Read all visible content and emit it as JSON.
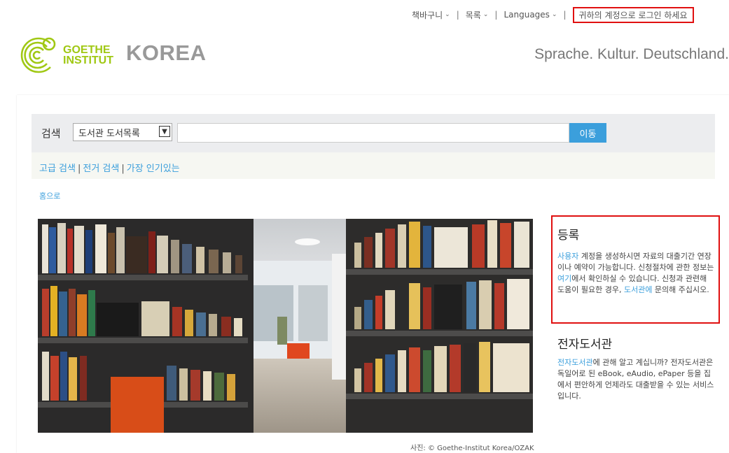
{
  "topnav": {
    "cart": "책바구니",
    "list": "목록",
    "languages": "Languages",
    "login": "귀하의 계정으로 로그인 하세요"
  },
  "header": {
    "logo_line1": "GOETHE",
    "logo_line2": "INSTITUT",
    "site_name": "KOREA",
    "tagline": "Sprache. Kultur. Deutschland."
  },
  "search": {
    "label": "검색",
    "scope": "도서관 도서목록",
    "query": "",
    "button": "이동"
  },
  "links": {
    "advanced": "고급 검색",
    "authority": "전거 검색",
    "popular": "가장 인기있는"
  },
  "breadcrumb": {
    "home": "홈으로"
  },
  "photo": {
    "caption": "사진: © Goethe-Institut Korea/OZAK"
  },
  "registration": {
    "title": "등록",
    "t1_link": "사용자",
    "t1": " 계정을 생성하시면 자료의 대출기간 연장이나 예약이 가능합니다. 신청절차에 관한 정보는 ",
    "t2_link": "여기",
    "t2": "에서 확인하실 수 있습니다. 신청과 관련해 도움이 필요한 경우, ",
    "t3_link": "도서관에",
    "t3": " 문의해 주십시오."
  },
  "elibrary": {
    "title": "전자도서관",
    "t1_link": "전자도서관",
    "t1": "에 관해 알고 계십니까? 전자도서관은 독일어로 된 eBook, eAudio, ePaper 등을 집에서 편안하게 언제라도 대출받을 수 있는 서비스입니다."
  },
  "colors": {
    "accent": "#3b9fdc",
    "brand_green": "#a0c814",
    "highlight_red": "#e01010"
  }
}
